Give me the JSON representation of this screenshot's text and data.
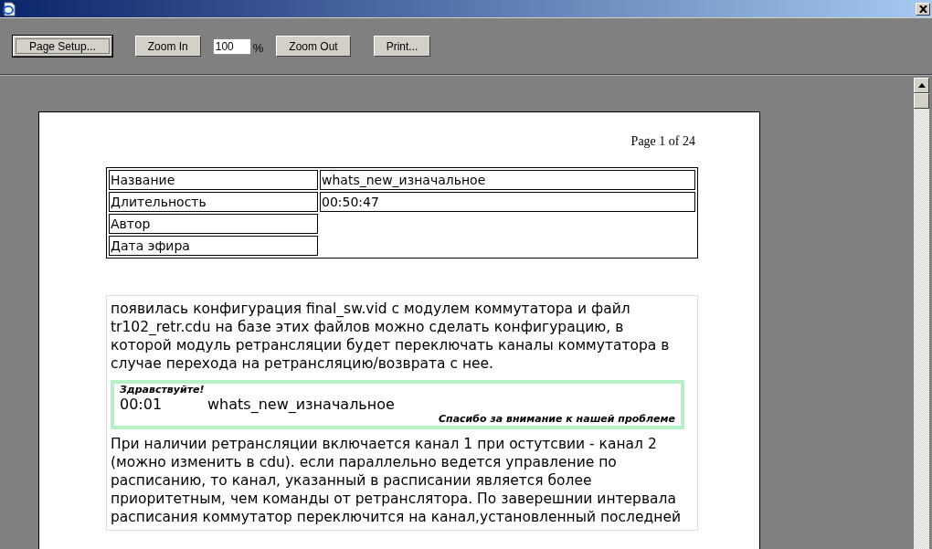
{
  "toolbar": {
    "buttons": [
      {
        "label": "Page Setup...",
        "focused": true
      },
      {
        "label": "Zoom In",
        "focused": false
      }
    ],
    "zoom": {
      "value": "100",
      "unit": "%"
    },
    "buttons_after": [
      {
        "label": "Zoom Out",
        "focused": false
      },
      {
        "label": "Print...",
        "focused": false
      }
    ]
  },
  "page": {
    "header": "Page 1 of 24",
    "info_table": [
      {
        "label": "Название",
        "value": "whats_new_изначальное"
      },
      {
        "label": "Длительность",
        "value": "00:50:47"
      },
      {
        "label": "Автор"
      },
      {
        "label": "Дата эфира"
      }
    ],
    "paragraph_1": "появилась конфигурация final_sw.vid с модулем коммутатора и файл tr102_retr.cdu на базе этих файлов можно сделать конфигурацию, в которой модуль ретрансляции будет переключать каналы коммутатора в случае перехода на ретрансляцию/возврата с нее.",
    "message": {
      "greeting": "Здравствуйте!",
      "time": "00:01",
      "title": "whats_new_изначальное",
      "signature": "Спасибо за внимание к нашей проблеме"
    },
    "paragraph_2": "При наличии ретрансляции включается канал 1 при остутсвии - канал 2 (можно изменить в cdu). если параллельно ведется управление по расписанию, то канал, указанный в расписании является более приоритетным, чем команды от ретранслятора. По заверешнии интервала расписания коммутатор переключится на канал,установленный последней"
  }
}
